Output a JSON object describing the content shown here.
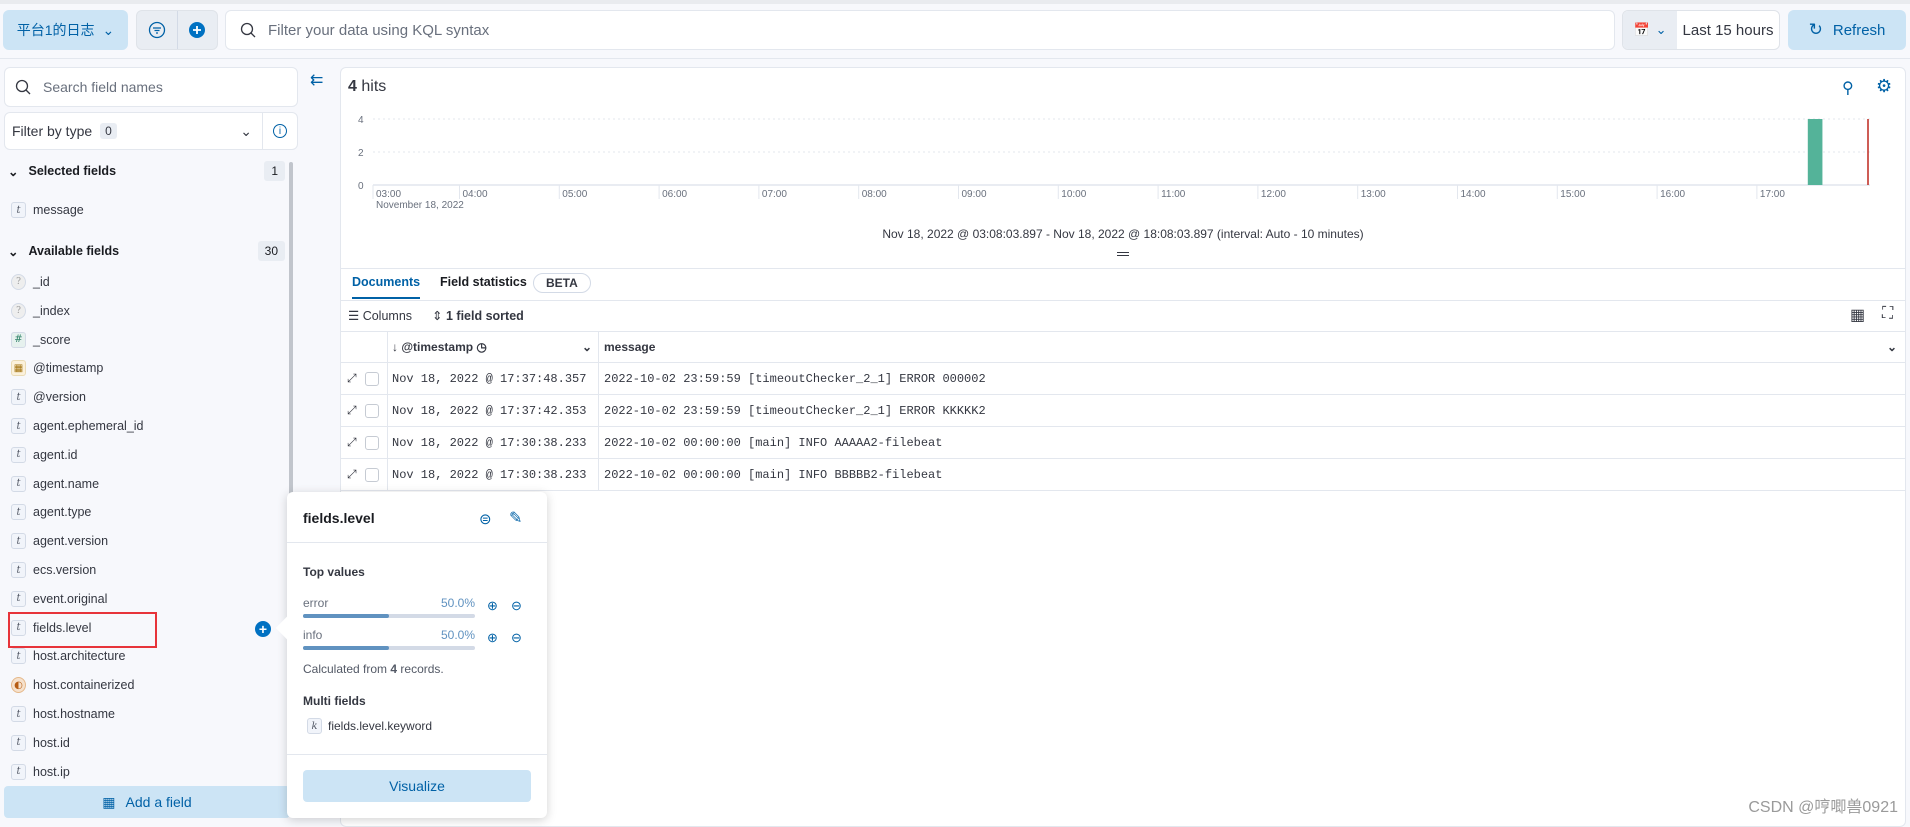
{
  "topbar": {
    "data_view": "平台1的日志",
    "query_placeholder": "Filter your data using KQL syntax",
    "date_range": "Last 15 hours",
    "refresh": "Refresh"
  },
  "sidebar": {
    "search_placeholder": "Search field names",
    "filter_by_type": "Filter by type",
    "filter_count": "0",
    "selected_header": "Selected fields",
    "selected_count": "1",
    "selected": [
      {
        "name": "message",
        "type": "t"
      }
    ],
    "available_header": "Available fields",
    "available_count": "30",
    "available": [
      {
        "name": "_id",
        "type": "?"
      },
      {
        "name": "_index",
        "type": "?"
      },
      {
        "name": "_score",
        "type": "#"
      },
      {
        "name": "@timestamp",
        "type": "date"
      },
      {
        "name": "@version",
        "type": "t"
      },
      {
        "name": "agent.ephemeral_id",
        "type": "t"
      },
      {
        "name": "agent.id",
        "type": "t"
      },
      {
        "name": "agent.name",
        "type": "t"
      },
      {
        "name": "agent.type",
        "type": "t"
      },
      {
        "name": "agent.version",
        "type": "t"
      },
      {
        "name": "ecs.version",
        "type": "t"
      },
      {
        "name": "event.original",
        "type": "t"
      },
      {
        "name": "fields.level",
        "type": "t"
      },
      {
        "name": "host.architecture",
        "type": "t"
      },
      {
        "name": "host.containerized",
        "type": "bool"
      },
      {
        "name": "host.hostname",
        "type": "t"
      },
      {
        "name": "host.id",
        "type": "t"
      },
      {
        "name": "host.ip",
        "type": "t"
      }
    ],
    "add_field": "Add a field"
  },
  "main": {
    "hits_count": "4",
    "hits_label": "hits",
    "interval_text": "Nov 18, 2022 @ 03:08:03.897 - Nov 18, 2022 @ 18:08:03.897 (interval: Auto - 10 minutes)",
    "tabs": [
      {
        "label": "Documents",
        "active": true
      },
      {
        "label": "Field statistics"
      }
    ],
    "beta": "BETA",
    "columns_btn": "Columns",
    "sorted_btn": "1 field sorted",
    "headers": [
      "@timestamp",
      "message"
    ],
    "rows": [
      [
        "Nov 18, 2022 @ 17:37:48.357",
        "2022-10-02 23:59:59 [timeoutChecker_2_1] ERROR 000002"
      ],
      [
        "Nov 18, 2022 @ 17:37:42.353",
        "2022-10-02 23:59:59 [timeoutChecker_2_1] ERROR KKKKK2"
      ],
      [
        "Nov 18, 2022 @ 17:30:38.233",
        "2022-10-02 00:00:00 [main] INFO AAAAA2-filebeat"
      ],
      [
        "Nov 18, 2022 @ 17:30:38.233",
        "2022-10-02 00:00:00 [main] INFO BBBBB2-filebeat"
      ]
    ]
  },
  "chart_data": {
    "type": "bar",
    "x_ticks": [
      "03:00",
      "04:00",
      "05:00",
      "06:00",
      "07:00",
      "08:00",
      "09:00",
      "10:00",
      "11:00",
      "12:00",
      "13:00",
      "14:00",
      "15:00",
      "16:00",
      "17:00"
    ],
    "x_sub_label": "November 18, 2022",
    "y_ticks": [
      "0",
      "2",
      "4"
    ],
    "ylim": [
      0,
      4
    ],
    "xlim": [
      "03:08",
      "18:08"
    ],
    "bars": [
      {
        "x": "17:30",
        "value": 4
      }
    ],
    "bar_color": "#54b399",
    "now_marker": "18:08",
    "now_color": "#bd271e",
    "grid": true
  },
  "popover": {
    "title": "fields.level",
    "top_values_label": "Top values",
    "values": [
      {
        "label": "error",
        "pct": "50.0%",
        "fraction": 0.5
      },
      {
        "label": "info",
        "pct": "50.0%",
        "fraction": 0.5
      }
    ],
    "calc_prefix": "Calculated from",
    "calc_count": "4",
    "calc_suffix": "records.",
    "multi_label": "Multi fields",
    "multi": [
      {
        "name": "fields.level.keyword",
        "type": "k"
      }
    ],
    "visualize": "Visualize"
  },
  "watermark": "CSDN @哼唧兽0921",
  "colors": {
    "accent": "#0061a6",
    "primary_light": "#cce4f5",
    "highlight": "#e7343a"
  }
}
